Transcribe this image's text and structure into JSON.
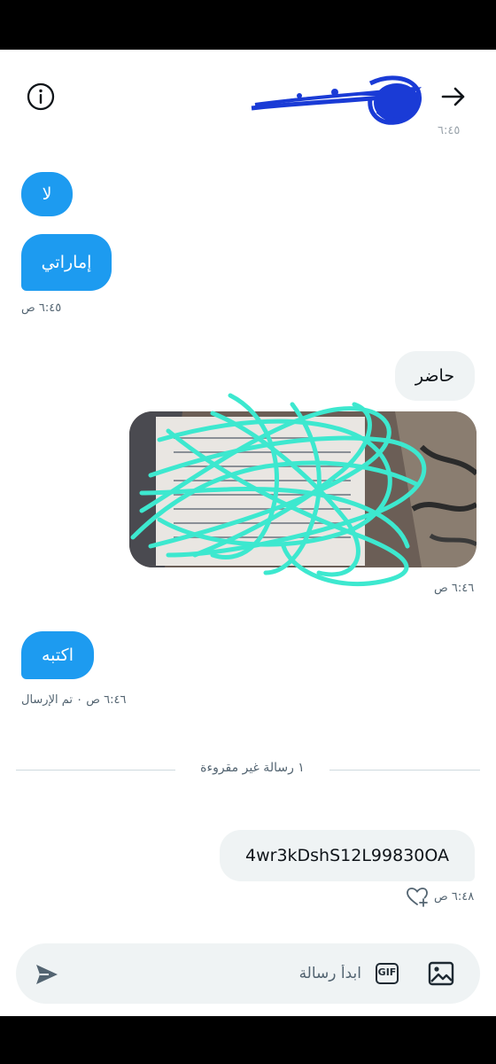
{
  "header": {
    "partial_timestamp": "٦:٤٥"
  },
  "messages": [
    {
      "id": "m1",
      "direction": "incoming",
      "text": "لا"
    },
    {
      "id": "m2",
      "direction": "incoming",
      "text": "إماراتي",
      "time": "٦:٤٥ ص"
    },
    {
      "id": "m3",
      "direction": "outgoing",
      "text": "حاضر"
    },
    {
      "id": "m4",
      "direction": "outgoing",
      "type": "image",
      "time": "٦:٤٦ ص"
    },
    {
      "id": "m5",
      "direction": "incoming",
      "text": "اكتبه",
      "time": "٦:٤٦ ص ٠ تم الإرسال"
    },
    {
      "id": "m6",
      "direction": "outgoing",
      "text": "4wr3kDshS12L99830OA",
      "time": "٦:٤٨ ص"
    }
  ],
  "divider": {
    "text": "١ رسالة غير مقروءة"
  },
  "composer": {
    "placeholder": "ابدأ رسالة",
    "gif_label": "GIF"
  },
  "icons": {
    "info": "info-icon",
    "back": "arrow-right-icon",
    "heart": "heart-add-icon",
    "send": "send-icon",
    "gif": "gif-icon",
    "media": "image-icon"
  },
  "colors": {
    "incoming_bubble": "#1d9bf0",
    "outgoing_bubble": "#eff3f4",
    "scribble_blue": "#1a3bd6",
    "scribble_teal": "#3de8cf"
  }
}
